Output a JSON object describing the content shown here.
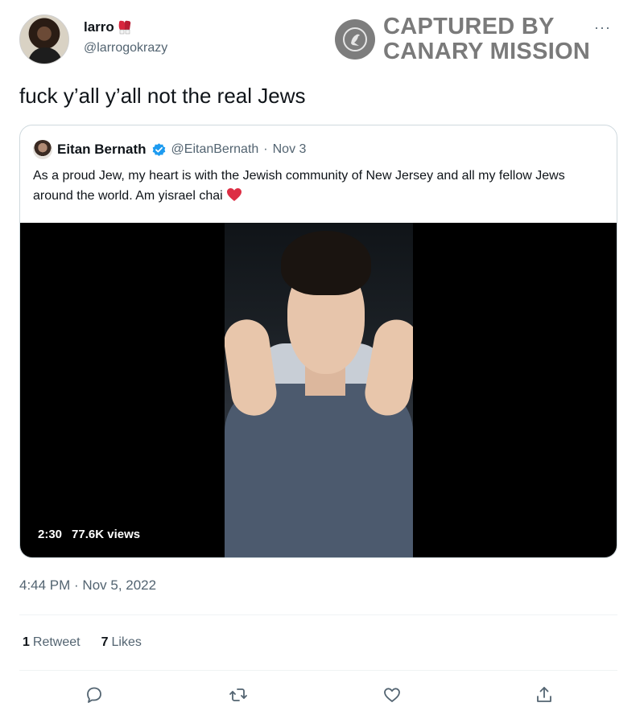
{
  "author": {
    "name": "larro",
    "handle": "@larrogokrazy",
    "name_emoji_icon": "boxing-gloves-icon"
  },
  "watermark": {
    "line1": "CAPTURED BY",
    "line2": "CANARY MISSION",
    "icon": "canary-bird-icon"
  },
  "more_menu": "···",
  "tweet": {
    "text": "fuck y’all y’all not the real Jews",
    "timestamp": "4:44 PM · Nov 5, 2022"
  },
  "quoted_tweet": {
    "name": "Eitan Bernath",
    "handle": "@EitanBernath",
    "separator": "·",
    "date": "Nov 3",
    "text": "As a proud Jew, my heart is with the Jewish community of New Jersey and all my fellow Jews around the world. Am yisrael chai",
    "video": {
      "duration": "2:30",
      "views": "77.6K views"
    }
  },
  "engagement": {
    "retweets_count": "1",
    "retweets_label": "Retweet",
    "likes_count": "7",
    "likes_label": "Likes"
  },
  "actions": [
    "reply-icon",
    "retweet-icon",
    "like-icon",
    "share-icon"
  ],
  "colors": {
    "text": "#0f1419",
    "secondary": "#536471",
    "border": "#cfd9de",
    "verified": "#1d9bf0",
    "heart": "#e0245e",
    "watermark": "#7a7a7a"
  }
}
